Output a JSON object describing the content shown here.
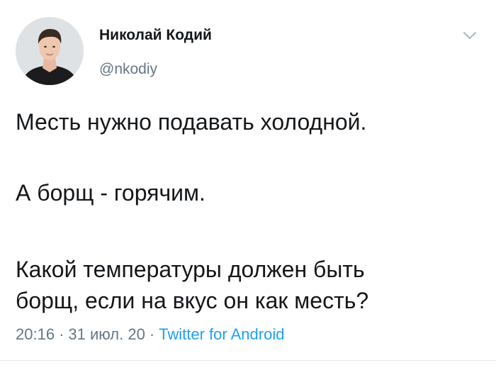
{
  "author": {
    "display_name": "Николай Кодий",
    "handle": "@nkodiy",
    "avatar": "avatar-photo"
  },
  "tweet": {
    "lines": [
      "Месть нужно подавать холодной.",
      "А борщ - горячим.",
      "Какой температуры должен быть",
      "борщ, если на вкус он как месть?"
    ],
    "time": "20:16",
    "date": "31 июл. 20",
    "separator": "·",
    "source": "Twitter for Android"
  },
  "icons": {
    "menu": "chevron-down-icon"
  },
  "colors": {
    "text": "#14171a",
    "secondary": "#657786",
    "link": "#1da1f2",
    "divider": "#e1e8ed"
  }
}
